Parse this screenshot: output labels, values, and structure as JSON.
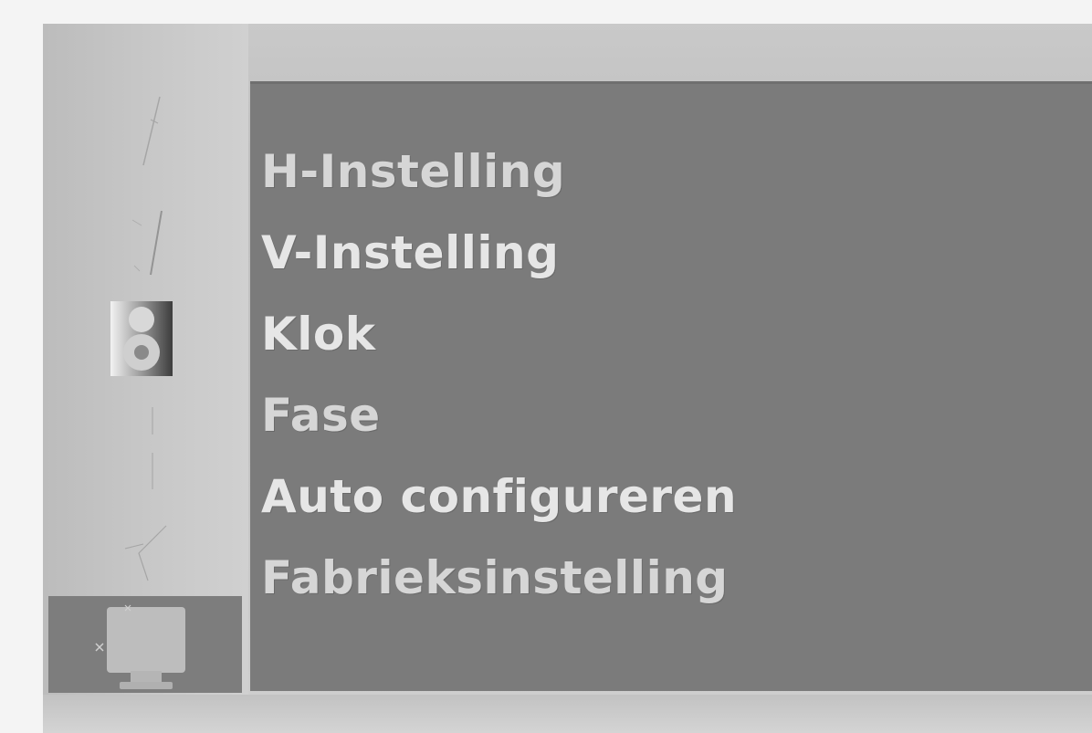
{
  "menu": {
    "items": [
      {
        "label": "H-Instelling"
      },
      {
        "label": "V-Instelling"
      },
      {
        "label": "Klok"
      },
      {
        "label": "Fase"
      },
      {
        "label": "Auto configureren"
      },
      {
        "label": "Fabrieksinstelling"
      }
    ]
  },
  "sidebar": {
    "icons": [
      {
        "name": "brightness-icon",
        "selected": false
      },
      {
        "name": "color-icon",
        "selected": false
      },
      {
        "name": "speaker-icon",
        "selected": false
      },
      {
        "name": "position-icon",
        "selected": false
      },
      {
        "name": "settings-icon",
        "selected": false
      },
      {
        "name": "monitor-setup-icon",
        "selected": true
      }
    ]
  },
  "colors": {
    "panel": "#7b7b7b",
    "frame": "#c6c6c6",
    "text": "#d6d6d6"
  }
}
